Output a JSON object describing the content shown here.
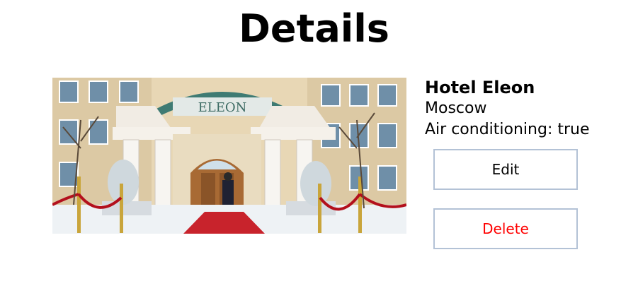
{
  "page": {
    "title": "Details"
  },
  "hotel": {
    "name": "Hotel Eleon",
    "city": "Moscow",
    "amenity_label": "Air conditioning: true",
    "image_alt": "Hotel Eleon entrance",
    "sign_text": "ELEON"
  },
  "actions": {
    "edit_label": "Edit",
    "delete_label": "Delete"
  },
  "colors": {
    "delete_text": "#ff0000",
    "button_border": "#b3c2d6"
  }
}
